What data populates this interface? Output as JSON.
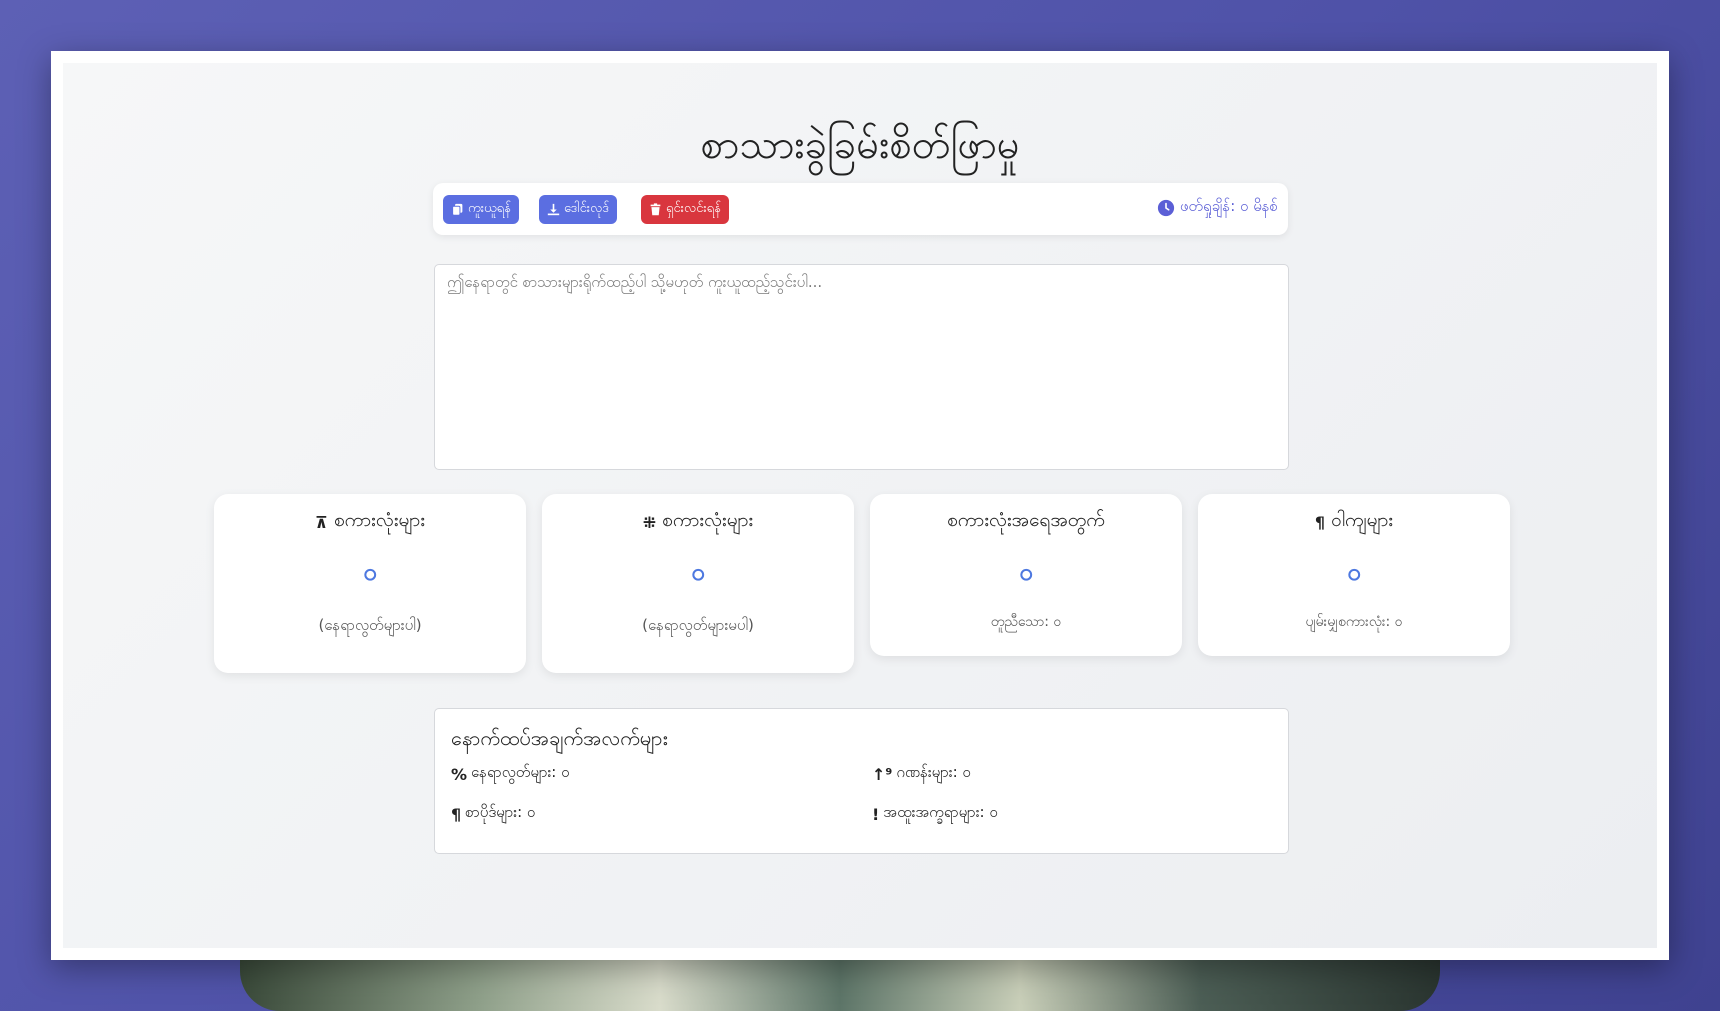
{
  "app": {
    "title": "စာသားခွဲခြမ်းစိတ်ဖြာမှု"
  },
  "toolbar": {
    "copy_label": "ကူးယူရန်",
    "download_label": "ဒေါင်းလုဒ်",
    "clear_label": "ရှင်းလင်းရန်",
    "read_time": "ဖတ်ရှုချိန်: ၀ မိနစ်"
  },
  "editor": {
    "placeholder": "ဤနေရာတွင် စာသားများရိုက်ထည့်ပါ သို့မဟုတ် ကူးယူထည့်သွင်းပါ...",
    "value": ""
  },
  "cards": [
    {
      "icon": "text-with-spaces-icon",
      "label": "စကားလုံးများ",
      "value": "၀",
      "sub": "(နေရာလွတ်များပါ)"
    },
    {
      "icon": "compress-icon",
      "label": "စကားလုံးများ",
      "value": "၀",
      "sub": "(နေရာလွတ်များမပါ)"
    },
    {
      "icon": "",
      "label": "စကားလုံးအရေအတွက်",
      "value": "၀",
      "sub": "တူညီသော: ၀"
    },
    {
      "icon": "paragraph-icon",
      "label": "ဝါကျများ",
      "value": "၀",
      "sub": "ပျမ်းမျှစကားလုံး: ၀"
    }
  ],
  "more": {
    "title": "နောက်ထပ်အချက်အလက်များ",
    "stats": [
      {
        "icon": "percent-icon",
        "label": "နေရာလွတ်များ: ၀"
      },
      {
        "icon": "sort-numeric-icon",
        "label": "ဂဏန်းများ: ၀"
      },
      {
        "icon": "paragraph-icon",
        "label": "စာပိုဒ်များ: ၀"
      },
      {
        "icon": "exclamation-icon",
        "label": "အထူးအက္ခရာများ: ၀"
      }
    ]
  },
  "colors": {
    "accent": "#5b6ee1",
    "danger": "#d9363e",
    "value": "#4d78e0",
    "read_time": "#5b5fd6"
  }
}
